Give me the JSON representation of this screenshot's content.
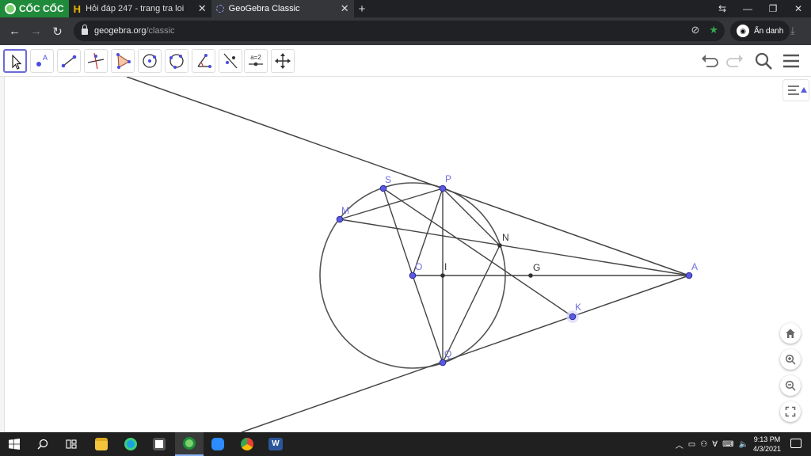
{
  "browser": {
    "brand": "CỐC CỐC",
    "tabs": [
      {
        "title": "Hỏi đáp 247 - trang tra loi",
        "favicon": "h-icon"
      },
      {
        "title": "GeoGebra Classic",
        "favicon": "geogebra-icon",
        "active": true
      }
    ],
    "address": {
      "host": "geogebra.org",
      "path": "/classic"
    },
    "profile_label": "Ẩn danh"
  },
  "toolbar": {
    "tools": [
      {
        "name": "move-tool",
        "active": true
      },
      {
        "name": "point-tool",
        "label": "A"
      },
      {
        "name": "segment-tool"
      },
      {
        "name": "perpendicular-line-tool"
      },
      {
        "name": "polygon-tool"
      },
      {
        "name": "circle-center-point-tool"
      },
      {
        "name": "circle-three-points-tool"
      },
      {
        "name": "angle-tool"
      },
      {
        "name": "reflect-tool"
      },
      {
        "name": "slider-tool",
        "label": "a=2"
      },
      {
        "name": "move-graphics-view-tool"
      }
    ],
    "right_buttons": [
      "undo-icon",
      "redo-icon",
      "search-icon",
      "menu-icon"
    ]
  },
  "geometry": {
    "point_labels": [
      "S",
      "P",
      "M",
      "N",
      "O",
      "I",
      "G",
      "A",
      "K",
      "Q"
    ],
    "colors": {
      "free_point": "#4b4bdc",
      "dependent_point": "#333333",
      "line": "#444444",
      "label_free": "#7070dd",
      "label_dependent": "#333333"
    }
  },
  "zoom_controls": [
    "home-icon",
    "zoom-in-icon",
    "zoom-out-icon",
    "fullscreen-icon"
  ],
  "taskbar": {
    "apps": [
      "windows-start-icon",
      "search-icon",
      "task-view-icon",
      "file-explorer-icon",
      "edge-icon",
      "store-icon",
      "coccoc-icon",
      "zoom-icon",
      "chrome-icon",
      "word-icon"
    ],
    "time": "9:13 PM",
    "date": "4/3/2021"
  }
}
